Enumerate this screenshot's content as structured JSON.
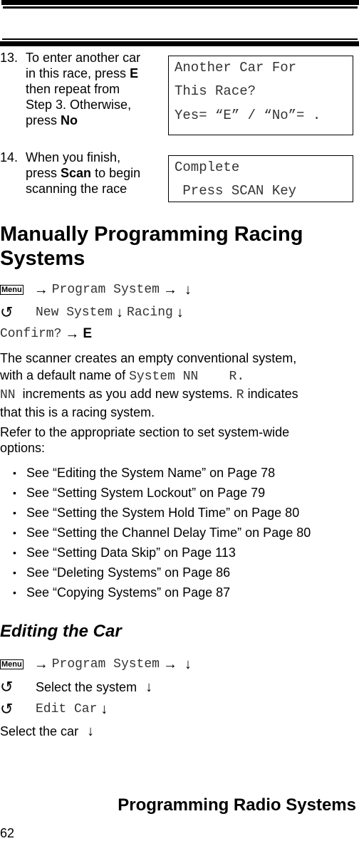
{
  "header": {
    "rules": [
      "thick",
      "thin",
      "thin",
      "thick"
    ]
  },
  "steps": [
    {
      "number": "13.",
      "lines": [
        [
          {
            "t": "To enter another car"
          }
        ],
        [
          {
            "t": "in this race, press "
          },
          {
            "t": "E",
            "bold": true
          }
        ],
        [
          {
            "t": "then repeat from"
          }
        ],
        [
          {
            "t": "Step 3. Otherwise,"
          }
        ],
        [
          {
            "t": "press "
          },
          {
            "t": "No",
            "bold": true
          }
        ]
      ],
      "display": [
        "Another Car For",
        "This Race?",
        "Yes= “E” / “No”= ."
      ]
    },
    {
      "number": "14.",
      "lines": [
        [
          {
            "t": "When you finish,"
          }
        ],
        [
          {
            "t": "press "
          },
          {
            "t": "Scan",
            "bold": true
          },
          {
            "t": " to begin"
          }
        ],
        [
          {
            "t": "scanning the race"
          }
        ]
      ],
      "display": [
        "Complete",
        " Press SCAN Key"
      ]
    }
  ],
  "section1": {
    "title_line1": "Manually Programming Racing",
    "title_line2": "Systems",
    "sequence": {
      "menu_key": "Menu",
      "line1": {
        "item": "Program System"
      },
      "line2": {
        "item1": "New System",
        "item2": "Racing"
      },
      "line3": {
        "item": "Confirm?",
        "key": "E"
      }
    },
    "icons": {
      "arrow_right": "→",
      "arrow_down": "↓",
      "rotate": "↺"
    },
    "paragraph1": {
      "l1": "The scanner creates an empty conventional system,",
      "l2_text": "with a default name of ",
      "l2_code": "System NN    R.",
      "l3_code1": "NN",
      "l3_text1": "  increments as you add new systems. ",
      "l3_code2": "R",
      "l3_text2": " indicates",
      "l4": "that this is a racing system."
    },
    "paragraph2": {
      "l1": "Refer to the appropriate section to set system-wide",
      "l2": "options:"
    },
    "bullet_glyph": "•",
    "bullets": [
      "See “Editing the System Name” on Page 78",
      "See “Setting System Lockout” on Page 79",
      "See “Setting the System Hold Time” on Page 80",
      "See “Setting the Channel Delay Time” on Page 80",
      "See “Setting Data Skip” on Page 113",
      "See “Deleting Systems” on Page 86",
      "See “Copying Systems” on Page 87"
    ]
  },
  "section2": {
    "title": "Editing the Car",
    "sequence": {
      "menu_key": "Menu",
      "line1": {
        "item": "Program System"
      },
      "line2": {
        "text": "Select the system"
      },
      "line3": {
        "item": "Edit Car"
      },
      "line4": {
        "text": "Select the car"
      }
    }
  },
  "footer": {
    "chapter_title": "Programming Radio Systems",
    "page_number": "62"
  }
}
